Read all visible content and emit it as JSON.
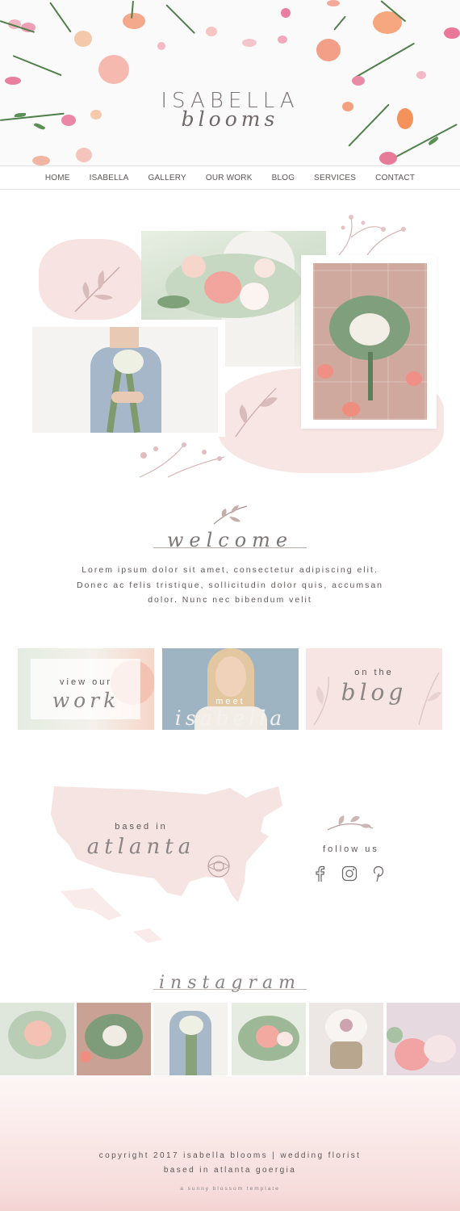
{
  "brand": {
    "name": "ISABELLA",
    "script": "blooms"
  },
  "nav": [
    "HOME",
    "ISABELLA",
    "GALLERY",
    "OUR WORK",
    "BLOG",
    "SERVICES",
    "CONTACT"
  ],
  "welcome": {
    "title": "welcome",
    "body": "Lorem ipsum dolor sit amet, consectetur adipiscing elit. Donec ac felis tristique, sollicitudin dolor quis, accumsan dolor. Nunc nec bibendum velit"
  },
  "tiles": [
    {
      "small": "view our",
      "script": "work"
    },
    {
      "small": "meet",
      "script": "isabella"
    },
    {
      "small": "on the",
      "script": "blog"
    }
  ],
  "location": {
    "small": "based in",
    "script": "atlanta"
  },
  "social": {
    "label": "follow us",
    "icons": [
      "facebook-icon",
      "instagram-icon",
      "pinterest-icon"
    ]
  },
  "instagram": {
    "title": "instagram"
  },
  "footer": {
    "line1": "copyright 2017 isabella blooms | wedding florist",
    "line2": "based in atlanta goergia",
    "line3": "a sunny blossom template"
  },
  "colors": {
    "accent": "#e9c5c3",
    "text": "#5d5656",
    "leaf": "#4f7f4a"
  }
}
